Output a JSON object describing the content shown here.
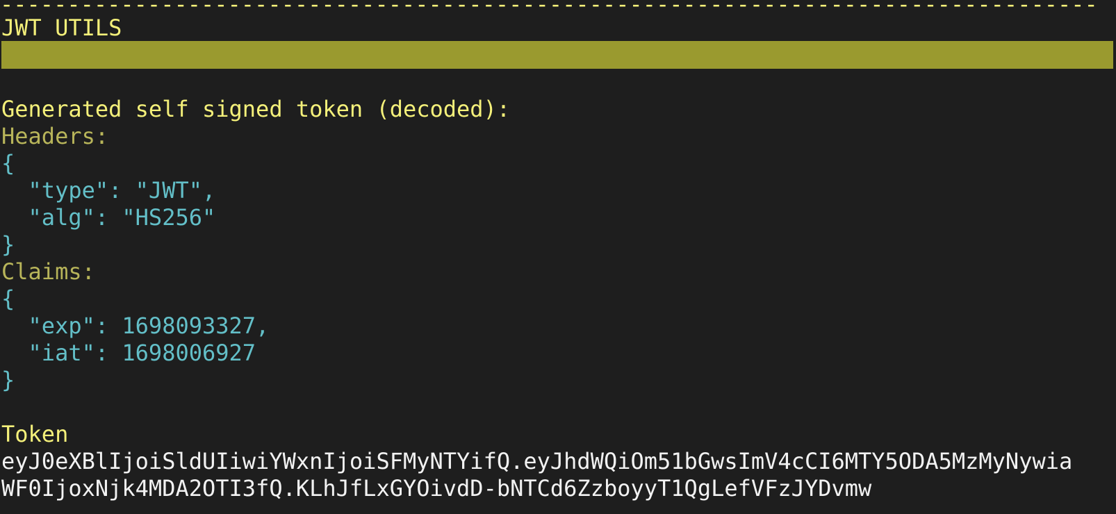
{
  "terminal": {
    "rule": "----------------------------------------------------------------------------------",
    "title": "JWT UTILS",
    "section_heading": "Generated self signed token (decoded):",
    "headers_label": "Headers:",
    "headers_open": "{",
    "header_type_line": "  \"type\": \"JWT\",",
    "header_alg_line": "  \"alg\": \"HS256\"",
    "headers_close": "}",
    "claims_label": "Claims:",
    "claims_open": "{",
    "claim_exp_line": "  \"exp\": 1698093327,",
    "claim_iat_line": "  \"iat\": 1698006927",
    "claims_close": "}",
    "token_label": "Token",
    "token_line_1": "eyJ0eXBlIjoiSldUIiwiYWxnIjoiSFMyNTYifQ.eyJhdWQiOm51bGwsImV4cCI6MTY5ODA5MzMyNywia",
    "token_line_2": "WF0IjoxNjk4MDA2OTI3fQ.KLhJfLxGYOivdD-bNTCd6ZzboyyT1QgLefVFzJYDvmw"
  },
  "colors": {
    "background": "#1e1e1e",
    "title_yellow": "#f4f07a",
    "label_olive": "#b8b55a",
    "json_cyan": "#63bfc8",
    "token_white": "#f2f2f2",
    "highlight_bar": "#9a9a2f"
  }
}
